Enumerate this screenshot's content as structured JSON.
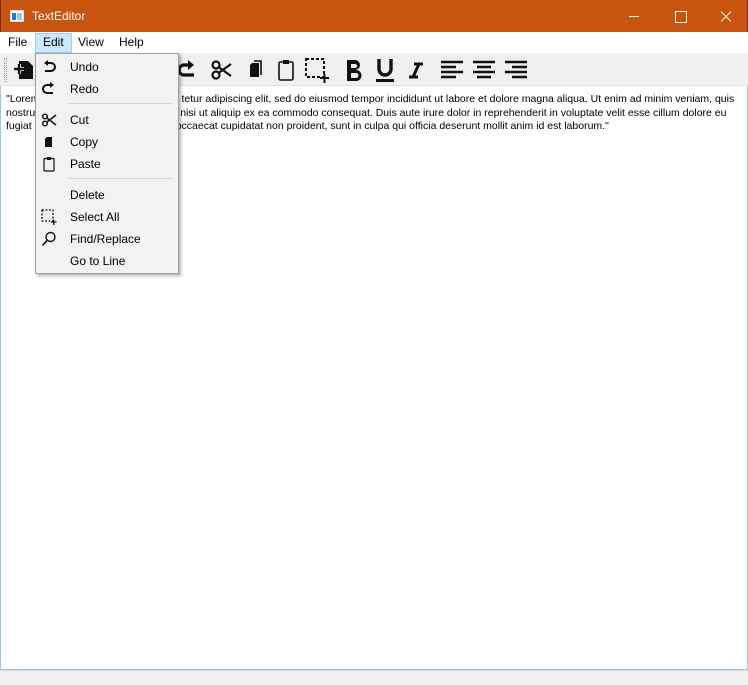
{
  "window": {
    "title": "TextEditor",
    "title_bar_color": "#c9540f",
    "controls": [
      "minimize-icon",
      "maximize-icon",
      "close-icon"
    ]
  },
  "menubar": {
    "items": [
      {
        "label": "File"
      },
      {
        "label": "Edit",
        "state": "open"
      },
      {
        "label": "View"
      },
      {
        "label": "Help"
      }
    ]
  },
  "toolbar": {
    "buttons": [
      "new-file-icon",
      "undo-icon",
      "redo-icon",
      "cut-icon",
      "copy-icon",
      "paste-icon",
      "select-all-icon",
      "bold-icon",
      "underline-icon",
      "italic-icon",
      "align-left-icon",
      "align-center-icon",
      "align-right-icon"
    ]
  },
  "edit_menu": {
    "items": [
      {
        "label": "Undo",
        "icon": "undo-icon"
      },
      {
        "label": "Redo",
        "icon": "redo-icon"
      },
      {
        "label": "Cut",
        "icon": "cut-icon"
      },
      {
        "label": "Copy",
        "icon": "copy-icon"
      },
      {
        "label": "Paste",
        "icon": "paste-icon"
      },
      {
        "label": "Delete",
        "icon": ""
      },
      {
        "label": "Select All",
        "icon": "select-all-icon"
      },
      {
        "label": "Find/Replace",
        "icon": "search-icon"
      },
      {
        "label": "Go to Line",
        "icon": ""
      }
    ]
  },
  "editor": {
    "line1_visible_start": "\"Lorem",
    "line1_visible_end": "tetur adipiscing elit, sed do eiusmod tempor incididunt ut labore et dolore magna aliqua. Ut enim ad minim veniam, quis",
    "line2_visible_start": "nostru",
    "line2_visible_end": "nisi ut aliquip ex ea commodo consequat. Duis aute irure dolor in reprehenderit in voluptate velit esse cillum dolore eu",
    "line3_visible_start": "fugiat",
    "line3_visible_end": "occaecat cupidatat non proident, sunt in culpa qui officia deserunt mollit anim id est laborum.\""
  }
}
